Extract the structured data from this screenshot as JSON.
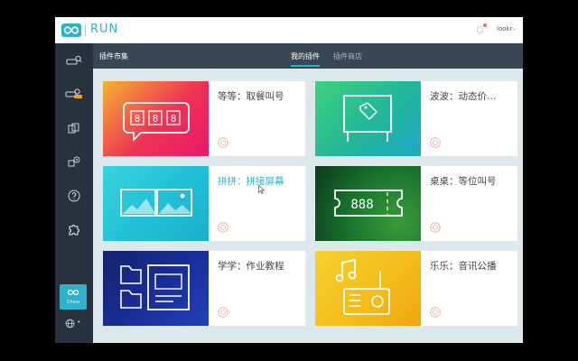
{
  "header": {
    "brand": "RUN",
    "user": "lookr",
    "colors": {
      "accent": "#2eb1c9",
      "sidebar": "#28313d",
      "subnav": "#394654",
      "notify_dot": "#ff6b6b"
    }
  },
  "sidebar": {
    "items": [
      {
        "icon": "ticket-search-icon",
        "label": ""
      },
      {
        "icon": "ticket-check-icon",
        "label": ""
      },
      {
        "icon": "document-icon",
        "label": ""
      },
      {
        "icon": "camera-settings-icon",
        "label": ""
      },
      {
        "icon": "help-icon",
        "label": ""
      },
      {
        "icon": "puzzle-icon",
        "label": ""
      }
    ],
    "region": "China",
    "language_icon": "globe-icon"
  },
  "subnav": {
    "title": "插件市集",
    "tabs": [
      {
        "label": "我的插件",
        "active": true
      },
      {
        "label": "插件商店",
        "active": false
      }
    ]
  },
  "plugins": [
    {
      "title": "等等：取餐叫号",
      "thumb_icon": "speech-bubble-888-icon",
      "gradient": [
        "#f6b232",
        "#ee3355",
        "#e8186c"
      ]
    },
    {
      "title": "波波：动态价…",
      "thumb_icon": "price-tag-board-icon",
      "gradient": [
        "#3fd27b",
        "#22b59a",
        "#1fa9c4"
      ]
    },
    {
      "title": "拼拼：拼接屏幕",
      "thumb_icon": "split-screen-icon",
      "gradient": [
        "#38d3de",
        "#22bfd5",
        "#1aaecb"
      ],
      "highlighted": true
    },
    {
      "title": "桌桌：等位叫号",
      "thumb_icon": "ticket-888-icon",
      "gradient": [
        "#0b3a19",
        "#1b7a30",
        "#3a9a3a"
      ]
    },
    {
      "title": "学学：作业教程",
      "thumb_icon": "folder-document-icon",
      "gradient": [
        "#15226e",
        "#1a2e9a",
        "#2340b8"
      ]
    },
    {
      "title": "乐乐：音讯公播",
      "thumb_icon": "music-radio-icon",
      "gradient": [
        "#f6d12e",
        "#f4bd1c",
        "#f0a412"
      ]
    }
  ]
}
